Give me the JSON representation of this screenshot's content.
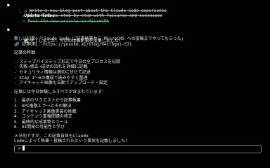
{
  "todos": {
    "header": "Update Todos",
    "items": [
      {
        "box": "☒",
        "text": "Write a new blog post about the Claude Code experience",
        "state": "done"
      },
      {
        "box": "☒",
        "text": "Structure as step-by-step with failures and successes",
        "state": "done"
      },
      {
        "box": "☒",
        "text": "Post the new article to MicroCMS",
        "state": "done"
      }
    ]
  },
  "message": {
    "status_line": "完了しました！今日の体験記事を投稿しました！",
    "new_article": "新しい記事：「Claude Code に記事執筆から MicroCMS への投稿までやってもらった」",
    "url_label": "🔗 記事URL: https://yosuke.ai/blog/94clbgol-53i",
    "features_heading": "記事の特徴",
    "features": [
      "- ステップバイステップ形式で今日の全プロセスを記録",
      "- 失敗→修正→成功の流れを詳細に記載",
      "- セキュリティ情報は適切に伏せて記述",
      "- Step 1〜6の構成で読みやすく整理",
      "- アイキャッチ画像も自動でアップロード・設定"
    ],
    "contents_heading": "記事には今日体験したすべてが含まれています：",
    "contents": [
      "1. 最初のリクエストから記事執筆",
      "2. API権限エラーとその解決",
      "3. アイキャッチ画像実装の挑戦",
      "4. コンテンツ重複問題の修正",
      "5. 最終的な成果物とツール",
      "6. AI開発の可能性と学び"
    ],
    "closing_1": "メタ的ですが、この記事自体もClaude",
    "closing_2": "Codeによって執筆・投稿されたという事実も記載しました！"
  },
  "prompt": {
    "symbol": ">",
    "value": ""
  }
}
